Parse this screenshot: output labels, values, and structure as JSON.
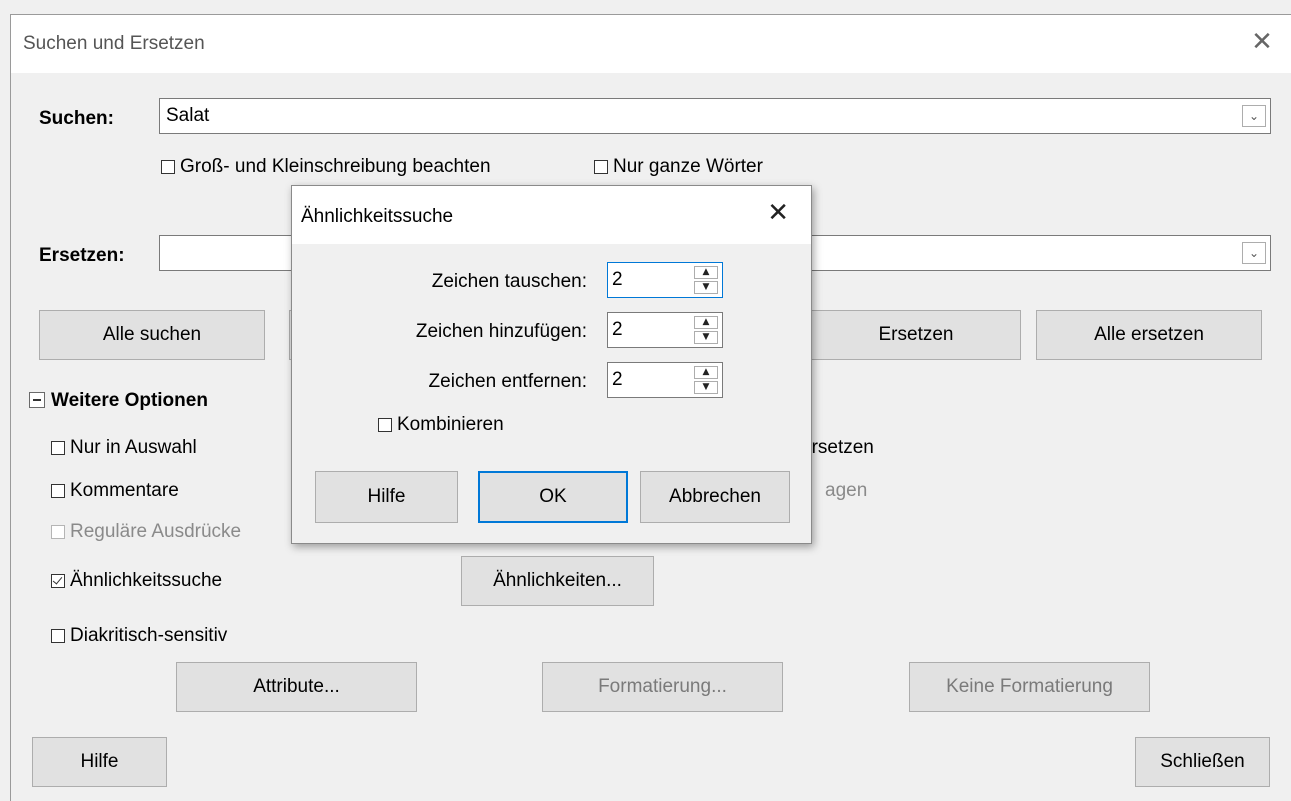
{
  "window": {
    "title": "Suchen und Ersetzen"
  },
  "search": {
    "label": "Suchen:",
    "value": "Salat"
  },
  "options_row": {
    "match_case": "Groß- und Kleinschreibung beachten",
    "whole_words": "Nur ganze Wörter"
  },
  "replace": {
    "label": "Ersetzen:",
    "value": ""
  },
  "buttons": {
    "find_all": "Alle suchen",
    "replace": "Ersetzen",
    "replace_all": "Alle ersetzen",
    "attributes": "Attribute...",
    "formatting": "Formatierung...",
    "no_formatting": "Keine Formatierung",
    "help": "Hilfe",
    "close": "Schließen",
    "similarities": "Ähnlichkeiten..."
  },
  "more_options": {
    "header": "Weitere Optionen",
    "current_selection": "Nur in Auswahl",
    "comments": "Kommentare",
    "regex": "Reguläre Ausdrücke",
    "similarity": "Ähnlichkeitssuche",
    "diacritics": "Diakritisch-sensitiv",
    "partial_right_1": "ersetzen",
    "partial_right_2": "agen"
  },
  "dialog": {
    "title": "Ähnlichkeitssuche",
    "exchange_label": "Zeichen tauschen:",
    "exchange_value": "2",
    "add_label": "Zeichen hinzufügen:",
    "add_value": "2",
    "remove_label": "Zeichen entfernen:",
    "remove_value": "2",
    "combine": "Kombinieren",
    "help": "Hilfe",
    "ok": "OK",
    "cancel": "Abbrechen"
  }
}
